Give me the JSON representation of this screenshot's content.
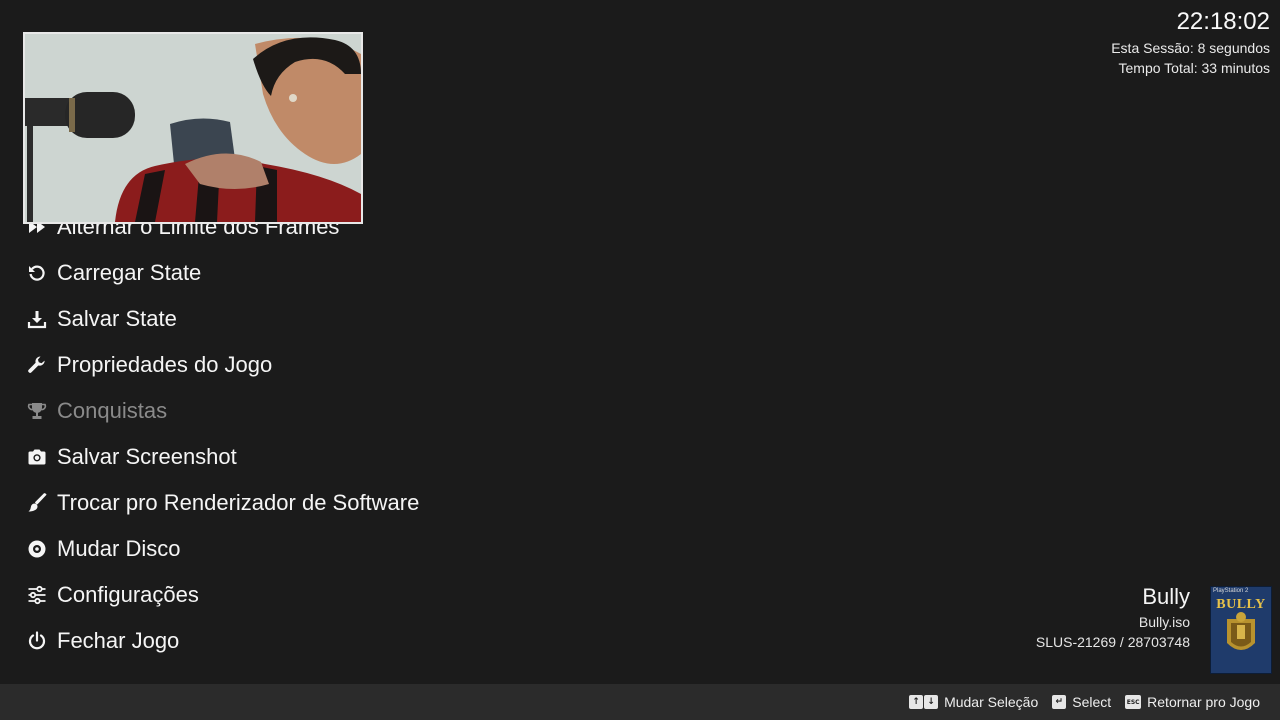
{
  "menu": {
    "items": [
      {
        "label": "Alternar o Limite dos Frames",
        "icon": "fast-forward-icon",
        "enabled": true
      },
      {
        "label": "Carregar State",
        "icon": "undo-icon",
        "enabled": true
      },
      {
        "label": "Salvar State",
        "icon": "download-icon",
        "enabled": true
      },
      {
        "label": "Propriedades do Jogo",
        "icon": "wrench-icon",
        "enabled": true
      },
      {
        "label": "Conquistas",
        "icon": "trophy-icon",
        "enabled": false
      },
      {
        "label": "Salvar Screenshot",
        "icon": "camera-icon",
        "enabled": true
      },
      {
        "label": "Trocar pro Renderizador de Software",
        "icon": "paintbrush-icon",
        "enabled": true
      },
      {
        "label": "Mudar Disco",
        "icon": "disc-icon",
        "enabled": true
      },
      {
        "label": "Configurações",
        "icon": "sliders-icon",
        "enabled": true
      },
      {
        "label": "Fechar Jogo",
        "icon": "power-icon",
        "enabled": true
      }
    ]
  },
  "status": {
    "clock": "22:18:02",
    "session": "Esta Sessão: 8 segundos",
    "total": "Tempo Total: 33 minutos"
  },
  "game": {
    "title": "Bully",
    "file": "Bully.iso",
    "serial": "SLUS-21269 / 28703748",
    "cover_brand": "PlayStation 2",
    "cover_title": "BULLY"
  },
  "hints": [
    {
      "keys": [
        "↑",
        "↓"
      ],
      "label": "Mudar Seleção"
    },
    {
      "keys": [
        "↵"
      ],
      "label": "Select"
    },
    {
      "keys": [
        "ESC"
      ],
      "label": "Retornar pro Jogo"
    }
  ],
  "colors": {
    "background": "#1b1b1b",
    "bottom_bar": "#2b2b2b",
    "text": "#f5f5f5",
    "disabled_text": "#8a8a8a"
  }
}
